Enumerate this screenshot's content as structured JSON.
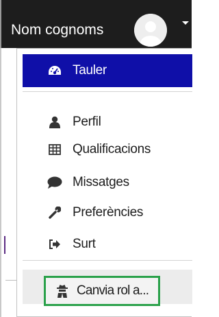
{
  "header": {
    "user_name": "Nom cognoms"
  },
  "menu": {
    "items": [
      {
        "label": "Tauler",
        "icon": "dashboard-icon"
      },
      {
        "label": "Perfil",
        "icon": "user-icon"
      },
      {
        "label": "Qualificacions",
        "icon": "table-icon"
      },
      {
        "label": "Missatges",
        "icon": "chat-bubble-icon"
      },
      {
        "label": "Preferències",
        "icon": "wrench-icon"
      },
      {
        "label": "Surt",
        "icon": "sign-out-icon"
      },
      {
        "label": "Canvia rol a...",
        "icon": "user-secret-icon"
      }
    ]
  },
  "colors": {
    "topbar": "#1d1d1d",
    "active_item": "#0f0fa8",
    "highlight_border": "#2aa14a"
  }
}
